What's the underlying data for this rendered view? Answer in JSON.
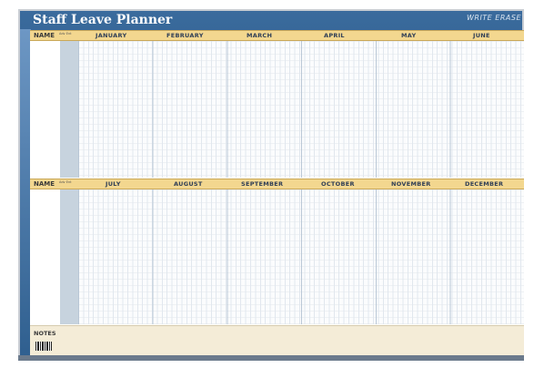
{
  "planner": {
    "title": "Staff Leave Planner",
    "brand": "WRITE ERASE",
    "name_label": "NAME",
    "mini_headers": "Adv Ent",
    "notes_label": "NOTES",
    "months_top": [
      "JANUARY",
      "FEBRUARY",
      "MARCH",
      "APRIL",
      "MAY",
      "JUNE"
    ],
    "months_bottom": [
      "JULY",
      "AUGUST",
      "SEPTEMBER",
      "OCTOBER",
      "NOVEMBER",
      "DECEMBER"
    ]
  },
  "colors": {
    "frame_blue": "#2b5580",
    "header_gold": "#f3d78f",
    "name_shade": "#c7d3de",
    "notes_bg": "#f4ecd7"
  },
  "icons": [
    "barcode-icon",
    "brand-logo"
  ]
}
